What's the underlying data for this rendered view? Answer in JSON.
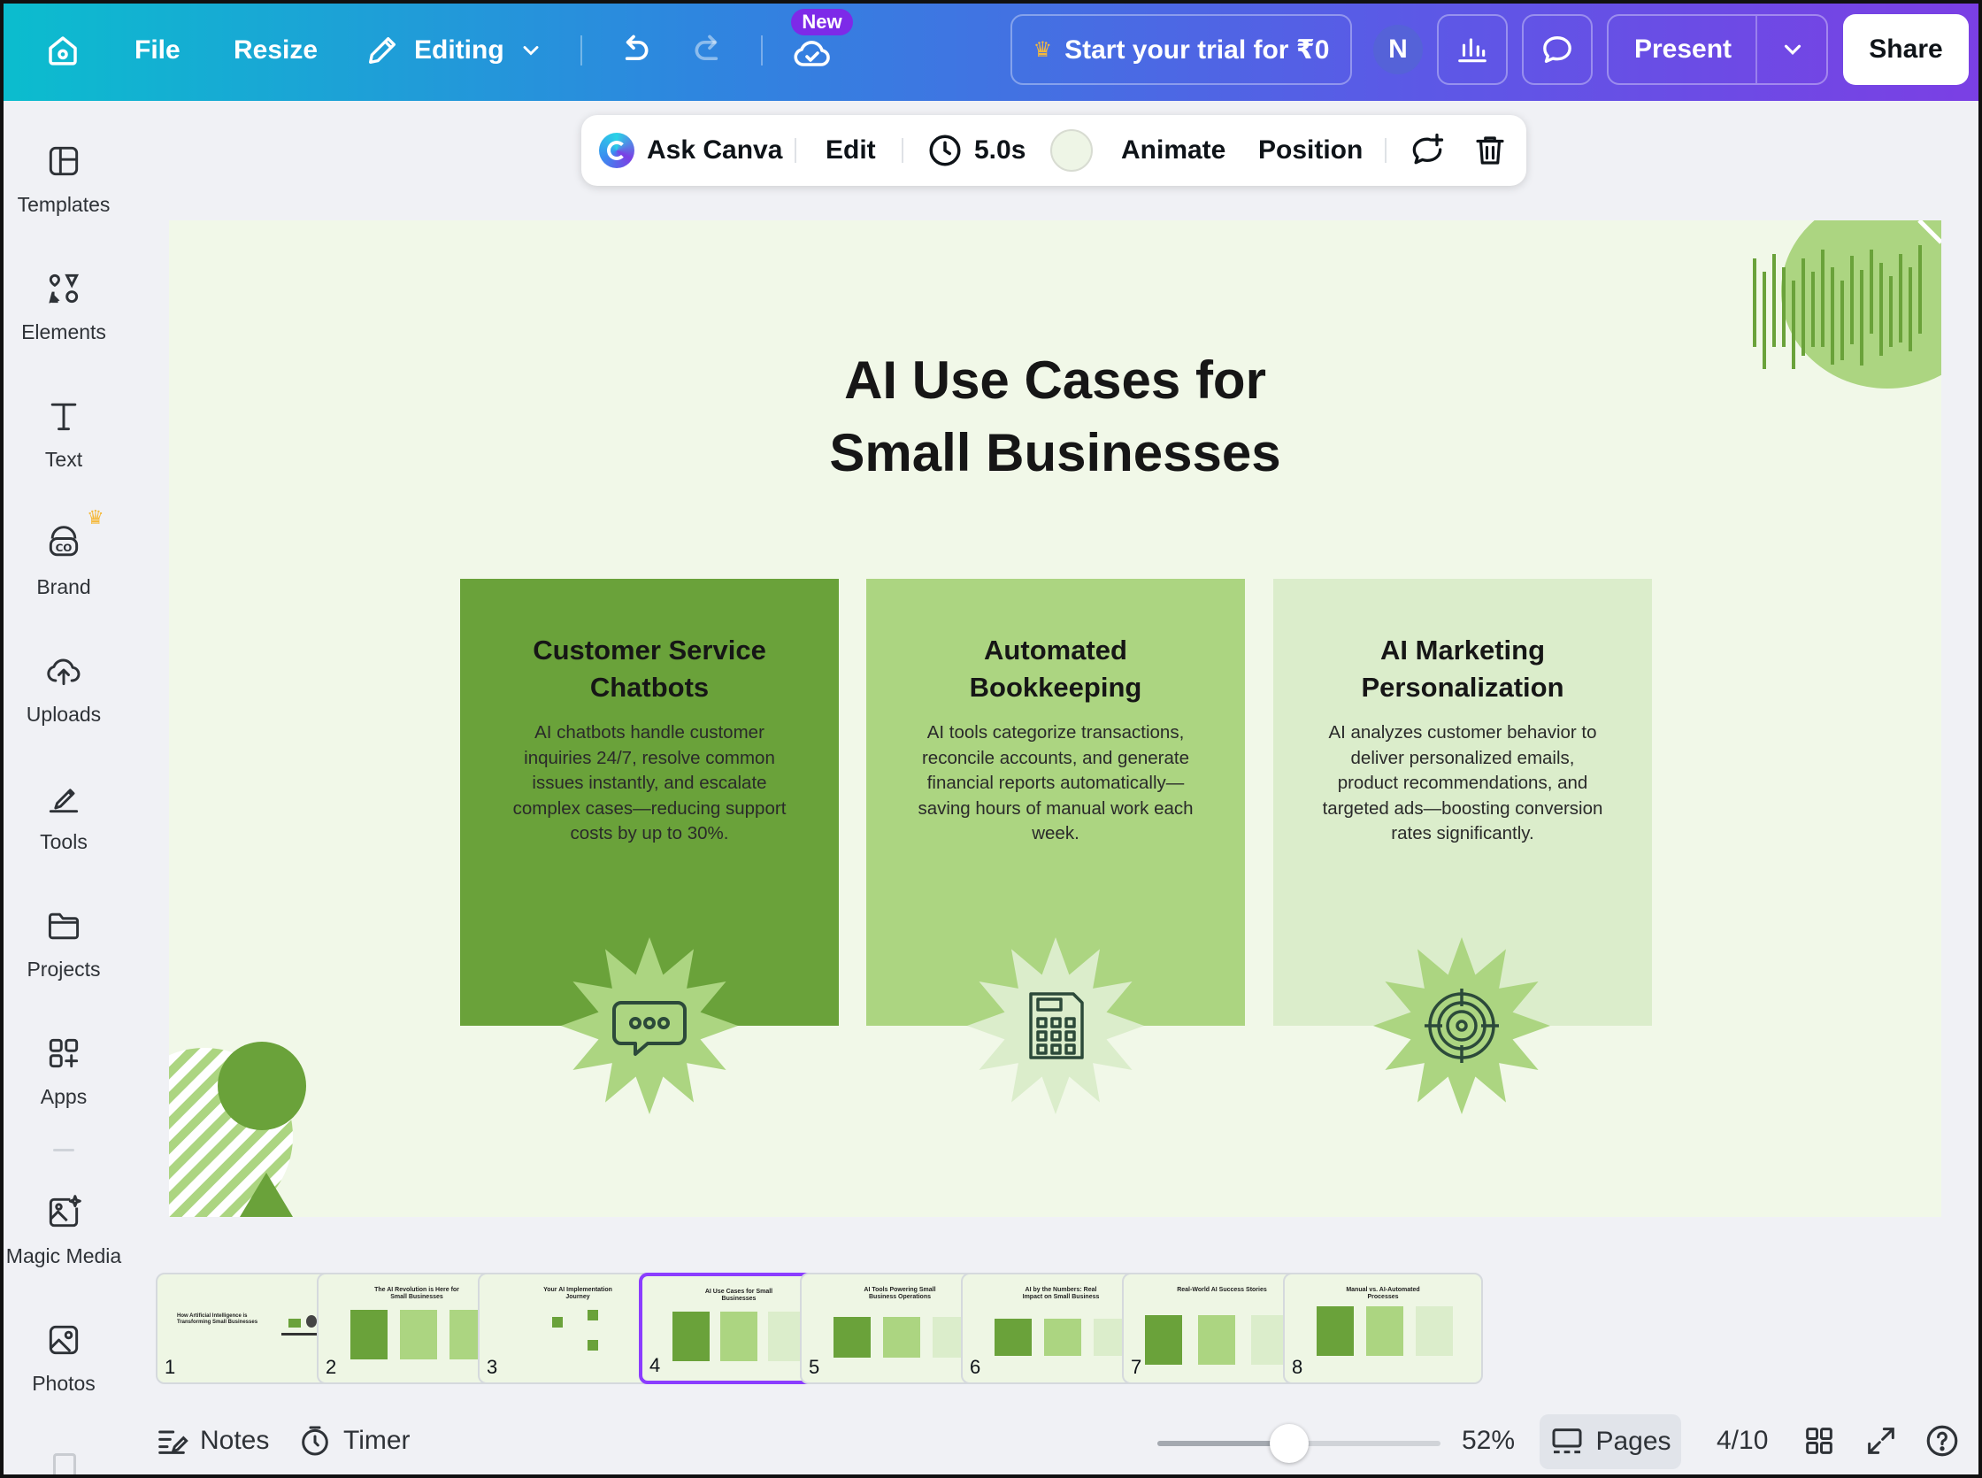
{
  "topbar": {
    "home_icon": "home-icon",
    "file_label": "File",
    "resize_label": "Resize",
    "mode_label": "Editing",
    "new_badge": "New",
    "trial_label": "Start your trial for ₹0",
    "avatar_initial": "N",
    "present_label": "Present",
    "share_label": "Share"
  },
  "sidebar": {
    "items": [
      {
        "label": "Templates",
        "icon": "templates-icon"
      },
      {
        "label": "Elements",
        "icon": "elements-icon"
      },
      {
        "label": "Text",
        "icon": "text-icon"
      },
      {
        "label": "Brand",
        "icon": "brand-icon"
      },
      {
        "label": "Uploads",
        "icon": "uploads-icon"
      },
      {
        "label": "Tools",
        "icon": "tools-icon"
      },
      {
        "label": "Projects",
        "icon": "projects-icon"
      },
      {
        "label": "Apps",
        "icon": "apps-icon"
      },
      {
        "label": "Magic Media",
        "icon": "magic-media-icon"
      },
      {
        "label": "Photos",
        "icon": "photos-icon"
      }
    ]
  },
  "toolbar": {
    "ask_label": "Ask Canva",
    "edit_label": "Edit",
    "duration_label": "5.0s",
    "animate_label": "Animate",
    "position_label": "Position",
    "bg_color": "#eef5e6"
  },
  "slide": {
    "title_line1": "AI Use Cases for",
    "title_line2": "Small Businesses",
    "cards": [
      {
        "title_line1": "Customer Service",
        "title_line2": "Chatbots",
        "body": "AI chatbots handle customer inquiries 24/7, resolve common issues instantly, and escalate complex cases—reducing support costs by up to 30%.",
        "icon": "chat-bubble-icon",
        "color": "#6aa23a"
      },
      {
        "title_line1": "Automated",
        "title_line2": "Bookkeeping",
        "body": "AI tools categorize transactions, reconcile accounts, and generate financial reports automatically—saving hours of manual work each week.",
        "icon": "calculator-icon",
        "color": "#acd581"
      },
      {
        "title_line1": "AI Marketing",
        "title_line2": "Personalization",
        "body": "AI analyzes customer behavior to deliver personalized emails, product recommendations, and targeted ads—boosting conversion rates significantly.",
        "icon": "target-icon",
        "color": "#dbedcb"
      }
    ]
  },
  "thumbnails": [
    {
      "num": "1",
      "title": "How Artificial Intelligence is Transforming Small Businesses"
    },
    {
      "num": "2",
      "title": "The AI Revolution is Here for Small Businesses"
    },
    {
      "num": "3",
      "title": "Your AI Implementation Journey"
    },
    {
      "num": "4",
      "title": "AI Use Cases for Small Businesses"
    },
    {
      "num": "5",
      "title": "AI Tools Powering Small Business Operations"
    },
    {
      "num": "6",
      "title": "AI by the Numbers: Real Impact on Small Business"
    },
    {
      "num": "7",
      "title": "Real-World AI Success Stories"
    },
    {
      "num": "8",
      "title": "Manual vs. AI-Automated Processes"
    }
  ],
  "bottom": {
    "notes_label": "Notes",
    "timer_label": "Timer",
    "zoom_label": "52%",
    "zoom_value": 52,
    "pages_label": "Pages",
    "page_counter": "4/10"
  }
}
